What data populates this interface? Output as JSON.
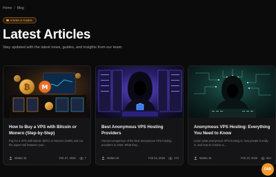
{
  "breadcrumb": {
    "home": "Home",
    "separator": "/",
    "current": "Blog"
  },
  "badge": {
    "label": "Articles & Guides",
    "icon": "book-icon"
  },
  "page": {
    "title": "Latest Articles",
    "subtitle": "Stay updated with the latest news, guides, and insights from our team."
  },
  "colors": {
    "accent": "#f39a2b",
    "background": "#0b0b0c",
    "card": "#151517"
  },
  "articles": [
    {
      "title": "How to Buy a VPS with Bitcoin or Monero (Step-by-Step)",
      "description": "Pay for a VPS with Bitcoin (BTC) or Monero (XMR) and cut the paper trail between your...",
      "author": "Matteo M.",
      "date": "Feb 27, 2026",
      "views": "7",
      "image_icon": "crypto-coins-image"
    },
    {
      "title": "Best Anonymous VPS Hosting Providers",
      "description": "Honest comparison of the best anonymous VPS hosting providers in 2026. What they...",
      "author": "Matteo M.",
      "date": "Feb 24, 2026",
      "views": "173",
      "image_icon": "hooded-hacker-image"
    },
    {
      "title": "Anonymous VPS Hosting: Everything You Need to Know",
      "description": "Learn what anonymous VPS hosting is, how private it really is, and how to choose a...",
      "author": "Matteo M.",
      "date": "Feb 13, 2026",
      "views": "561",
      "image_icon": "hooded-figure-image"
    }
  ],
  "fab": {
    "label": "FAB"
  }
}
